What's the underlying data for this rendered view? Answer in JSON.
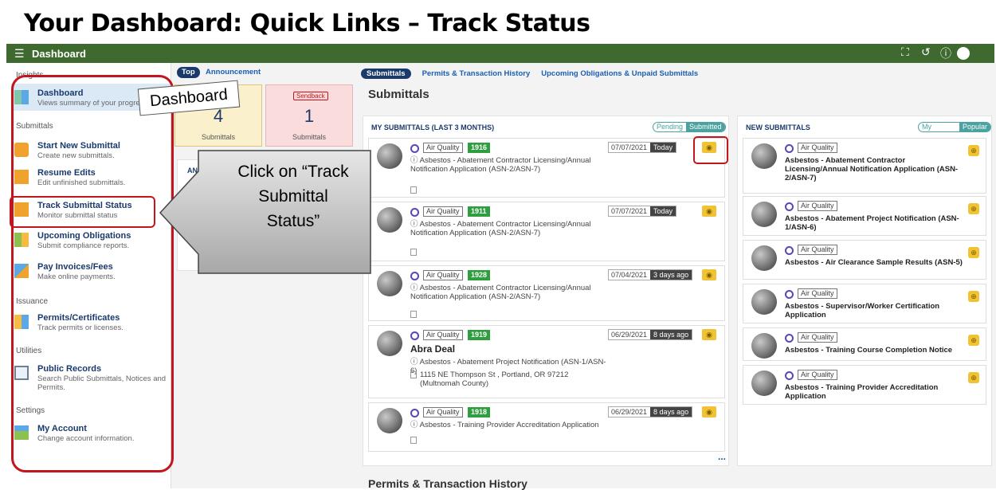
{
  "slide_title": "Your Dashboard: Quick Links – Track Status",
  "appbar": {
    "title": "Dashboard",
    "icons": [
      "fullscreen-icon",
      "history-icon",
      "help-icon",
      "user-icon"
    ]
  },
  "sidebar": {
    "sections": [
      {
        "label": "Insights"
      },
      {
        "label": "Submittals"
      },
      {
        "label": "Issuance"
      },
      {
        "label": "Utilities"
      },
      {
        "label": "Settings"
      }
    ],
    "items": [
      {
        "title": "Dashboard",
        "sub": "Views summary of your progress"
      },
      {
        "title": "Start New Submittal",
        "sub": "Create new submittals."
      },
      {
        "title": "Resume Edits",
        "sub": "Edit unfinished submittals."
      },
      {
        "title": "Track Submittal Status",
        "sub": "Monitor submittal status"
      },
      {
        "title": "Upcoming Obligations",
        "sub": "Submit compliance reports."
      },
      {
        "title": "Pay Invoices/Fees",
        "sub": "Make online payments."
      },
      {
        "title": "Permits/Certificates",
        "sub": "Track permits or licenses."
      },
      {
        "title": "Public Records",
        "sub": "Search Public Submittals, Notices and Permits."
      },
      {
        "title": "My Account",
        "sub": "Change account information."
      }
    ]
  },
  "callouts": {
    "dashboard": "Dashboard",
    "track": "Click on “Track Submittal Status”"
  },
  "middle": {
    "tab_top": "Top",
    "tab_announcement": "Announcement",
    "card1": {
      "number": "4",
      "label": "Submittals"
    },
    "card2": {
      "badge": "Sendback",
      "number": "1",
      "label": "Submittals"
    },
    "announce_heading": "ANNOU"
  },
  "main": {
    "tabs": [
      "Submittals",
      "Permits & Transaction History",
      "Upcoming Obligations & Unpaid Submittals"
    ],
    "heading": "Submittals",
    "my_submittals": {
      "heading": "MY SUBMITTALS (LAST 3 MONTHS)",
      "toggle": [
        "Pending",
        "Submitted"
      ],
      "rows": [
        {
          "tag": "Air Quality",
          "num": "1916",
          "desc": "Asbestos - Abatement Contractor Licensing/Annual Notification Application (ASN-2/ASN-7)",
          "date": "07/07/2021",
          "ago": "Today"
        },
        {
          "tag": "Air Quality",
          "num": "1911",
          "desc": "Asbestos - Abatement Contractor Licensing/Annual Notification Application (ASN-2/ASN-7)",
          "date": "07/07/2021",
          "ago": "Today"
        },
        {
          "tag": "Air Quality",
          "num": "1928",
          "desc": "Asbestos - Abatement Contractor Licensing/Annual Notification Application (ASN-2/ASN-7)",
          "date": "07/04/2021",
          "ago": "3 days ago"
        },
        {
          "tag": "Air Quality",
          "num": "1919",
          "name": "Abra Deal",
          "desc": "Asbestos - Abatement Project Notification (ASN-1/ASN-6)",
          "address": "1115 NE Thompson St , Portland, OR 97212 (Multnomah County)",
          "date": "06/29/2021",
          "ago": "8 days ago"
        },
        {
          "tag": "Air Quality",
          "num": "1918",
          "desc": "Asbestos - Training Provider Accreditation Application",
          "date": "06/29/2021",
          "ago": "8 days ago"
        }
      ],
      "more": "..."
    },
    "new_submittals": {
      "heading": "NEW SUBMITTALS",
      "toggle": [
        "My Favorite",
        "Popular"
      ],
      "rows": [
        {
          "tag": "Air Quality",
          "title": "Asbestos - Abatement Contractor Licensing/Annual Notification Application (ASN-2/ASN-7)"
        },
        {
          "tag": "Air Quality",
          "title": "Asbestos - Abatement Project Notification (ASN-1/ASN-6)"
        },
        {
          "tag": "Air Quality",
          "title": "Asbestos - Air Clearance Sample Results (ASN-5)"
        },
        {
          "tag": "Air Quality",
          "title": "Asbestos - Supervisor/Worker Certification Application"
        },
        {
          "tag": "Air Quality",
          "title": "Asbestos - Training Course Completion Notice"
        },
        {
          "tag": "Air Quality",
          "title": "Asbestos - Training Provider Accreditation Application"
        }
      ]
    },
    "permits_heading": "Permits & Transaction History"
  },
  "colors": {
    "appbar": "#3e6a2f",
    "accent_red": "#c4151c",
    "navy": "#1a3a6b",
    "badge_green": "#2e9e3e",
    "eye_yellow": "#f1c232"
  }
}
